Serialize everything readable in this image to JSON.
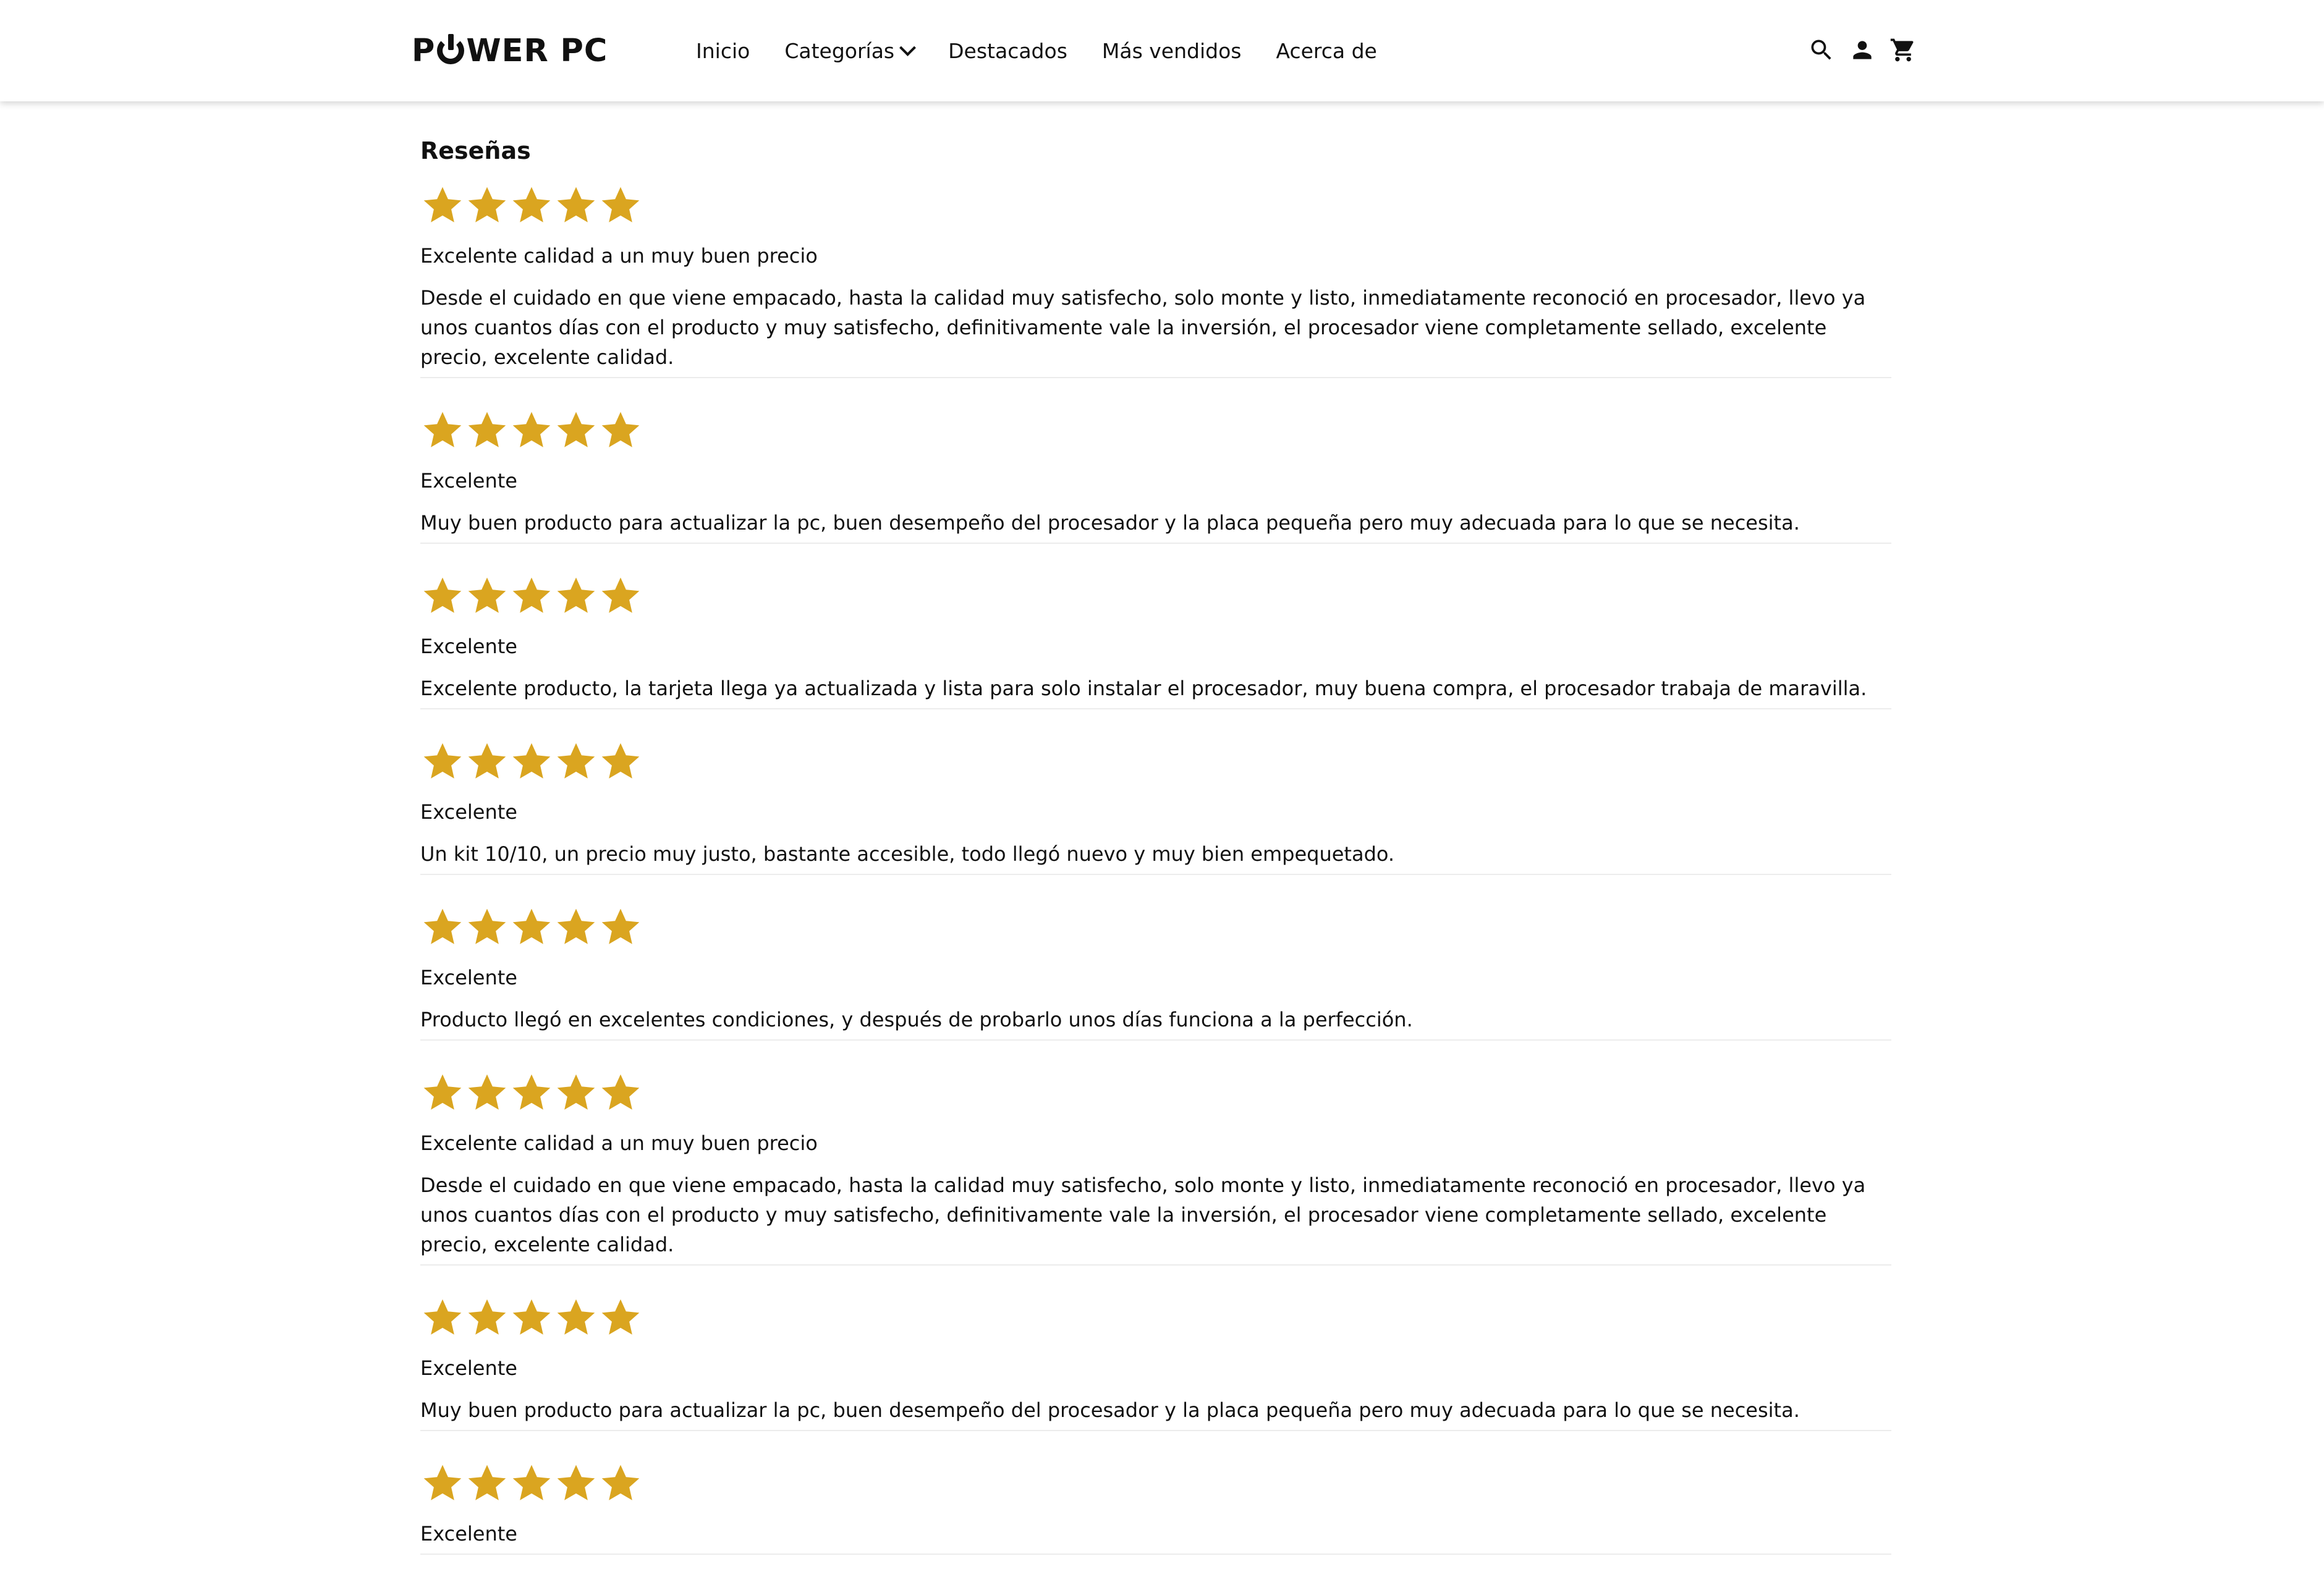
{
  "nav": {
    "logo_text": "POWER PC",
    "logo_part1": "P",
    "logo_part2": "WER PC",
    "links": [
      "Inicio",
      "Categorías",
      "Destacados",
      "Más vendidos",
      "Acerca de"
    ],
    "icons": [
      "search-icon",
      "user-icon",
      "cart-icon"
    ]
  },
  "reviews_section": {
    "title": "Reseñas",
    "star_color": "#DAA520",
    "max_rating": 5,
    "items": [
      {
        "rating": 5,
        "title": "Excelente calidad a un muy buen precio",
        "text": "Desde el cuidado en que viene empacado, hasta la calidad muy satisfecho, solo monte y listo, inmediatamente reconoció en procesador, llevo ya unos cuantos días con el producto y muy satisfecho, definitivamente vale la inversión, el procesador viene completamente sellado, excelente precio, excelente calidad."
      },
      {
        "rating": 5,
        "title": "Excelente",
        "text": "Muy buen producto para actualizar la pc, buen desempeño del procesador y la placa pequeña pero muy adecuada para lo que se necesita."
      },
      {
        "rating": 5,
        "title": "Excelente",
        "text": "Excelente producto, la tarjeta llega ya actualizada y lista para solo instalar el procesador, muy buena compra, el procesador trabaja de maravilla."
      },
      {
        "rating": 5,
        "title": "Excelente",
        "text": "Un kit 10/10, un precio muy justo, bastante accesible, todo llegó nuevo y muy bien empequetado."
      },
      {
        "rating": 5,
        "title": "Excelente",
        "text": "Producto llegó en excelentes condiciones, y después de probarlo unos días funciona a la perfección."
      },
      {
        "rating": 5,
        "title": "Excelente calidad a un muy buen precio",
        "text": "Desde el cuidado en que viene empacado, hasta la calidad muy satisfecho, solo monte y listo, inmediatamente reconoció en procesador, llevo ya unos cuantos días con el producto y muy satisfecho, definitivamente vale la inversión, el procesador viene completamente sellado, excelente precio, excelente calidad."
      },
      {
        "rating": 5,
        "title": "Excelente",
        "text": "Muy buen producto para actualizar la pc, buen desempeño del procesador y la placa pequeña pero muy adecuada para lo que se necesita."
      },
      {
        "rating": 5,
        "title": "Excelente",
        "text": ""
      }
    ]
  }
}
